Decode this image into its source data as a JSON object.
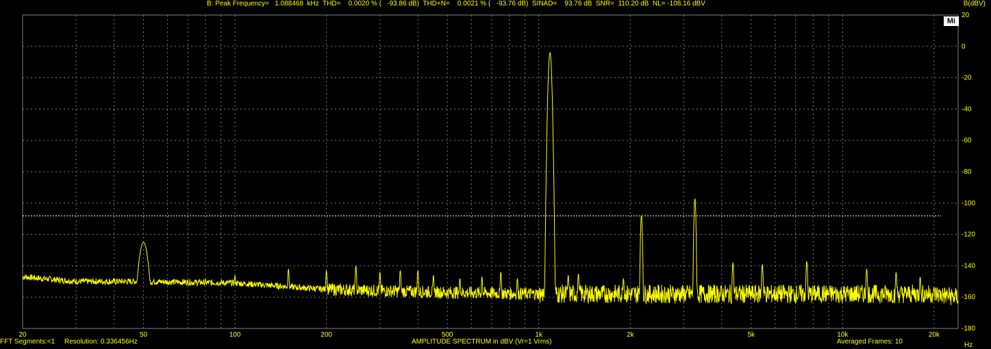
{
  "header": {
    "measurement": "B: Peak Frequency=   1.088468  kHz  THD=    0.0020 % (   -93.86 dB)  THD+N=    0.0021 % (   -93.76 dB)  SINAD=    93.76 dB  SNR=  110.20 dB  NL= -108.16 dBV",
    "y_unit": "B(dBV)"
  },
  "badge": "Mi",
  "footer": {
    "left": "FFT Segments:<1     Resolution: 0.336456Hz",
    "center": "AMPLITUDE SPECTRUM in dBV (Vr=1 Vrms)",
    "right": "Averaged Frames: 10",
    "x_unit": "Hz"
  },
  "colors": {
    "trace": "#ffff00",
    "grid": "#808080",
    "background": "#000000"
  },
  "chart_data": {
    "type": "line",
    "xlabel": "",
    "ylabel": "",
    "x_scale": "log",
    "xlim": [
      20,
      24000
    ],
    "ylim": [
      -180,
      20
    ],
    "x_ticks": [
      20,
      50,
      100,
      200,
      500,
      1000,
      2000,
      5000,
      10000,
      20000
    ],
    "x_tick_labels": [
      "20",
      "50",
      "100",
      "200",
      "500",
      "1k",
      "2k",
      "5k",
      "10k",
      "20k"
    ],
    "y_ticks": [
      20,
      0,
      -20,
      -40,
      -60,
      -80,
      -100,
      -120,
      -140,
      -160,
      -180
    ],
    "y_tick_labels": [
      "20",
      "0",
      "-20",
      "-40",
      "-60",
      "-80",
      "-100",
      "-120",
      "-140",
      "-160",
      "-180"
    ],
    "grid": true,
    "noise_level_line": -108.16,
    "series": [
      {
        "noise_floor": [
          [
            20,
            -147
          ],
          [
            30,
            -150
          ],
          [
            50,
            -150
          ],
          [
            100,
            -151
          ],
          [
            200,
            -155
          ],
          [
            500,
            -157
          ],
          [
            1000,
            -158
          ],
          [
            2000,
            -158
          ],
          [
            5000,
            -158
          ],
          [
            10000,
            -158
          ],
          [
            20000,
            -158
          ],
          [
            24000,
            -160
          ]
        ],
        "peaks": [
          {
            "x": 50,
            "y": -125
          },
          {
            "x": 100,
            "y": -146
          },
          {
            "x": 150,
            "y": -142
          },
          {
            "x": 200,
            "y": -143
          },
          {
            "x": 250,
            "y": -140
          },
          {
            "x": 300,
            "y": -144
          },
          {
            "x": 350,
            "y": -143
          },
          {
            "x": 400,
            "y": -143
          },
          {
            "x": 450,
            "y": -146
          },
          {
            "x": 550,
            "y": -148
          },
          {
            "x": 650,
            "y": -147
          },
          {
            "x": 750,
            "y": -144
          },
          {
            "x": 850,
            "y": -148
          },
          {
            "x": 1088.468,
            "y": -4
          },
          {
            "x": 1250,
            "y": -146
          },
          {
            "x": 1350,
            "y": -145
          },
          {
            "x": 1900,
            "y": -148
          },
          {
            "x": 2177,
            "y": -108
          },
          {
            "x": 3265,
            "y": -97
          },
          {
            "x": 4354,
            "y": -138
          },
          {
            "x": 5442,
            "y": -139
          },
          {
            "x": 7619,
            "y": -137
          },
          {
            "x": 12000,
            "y": -142
          },
          {
            "x": 15000,
            "y": -144
          },
          {
            "x": 18000,
            "y": -147
          }
        ]
      }
    ]
  }
}
